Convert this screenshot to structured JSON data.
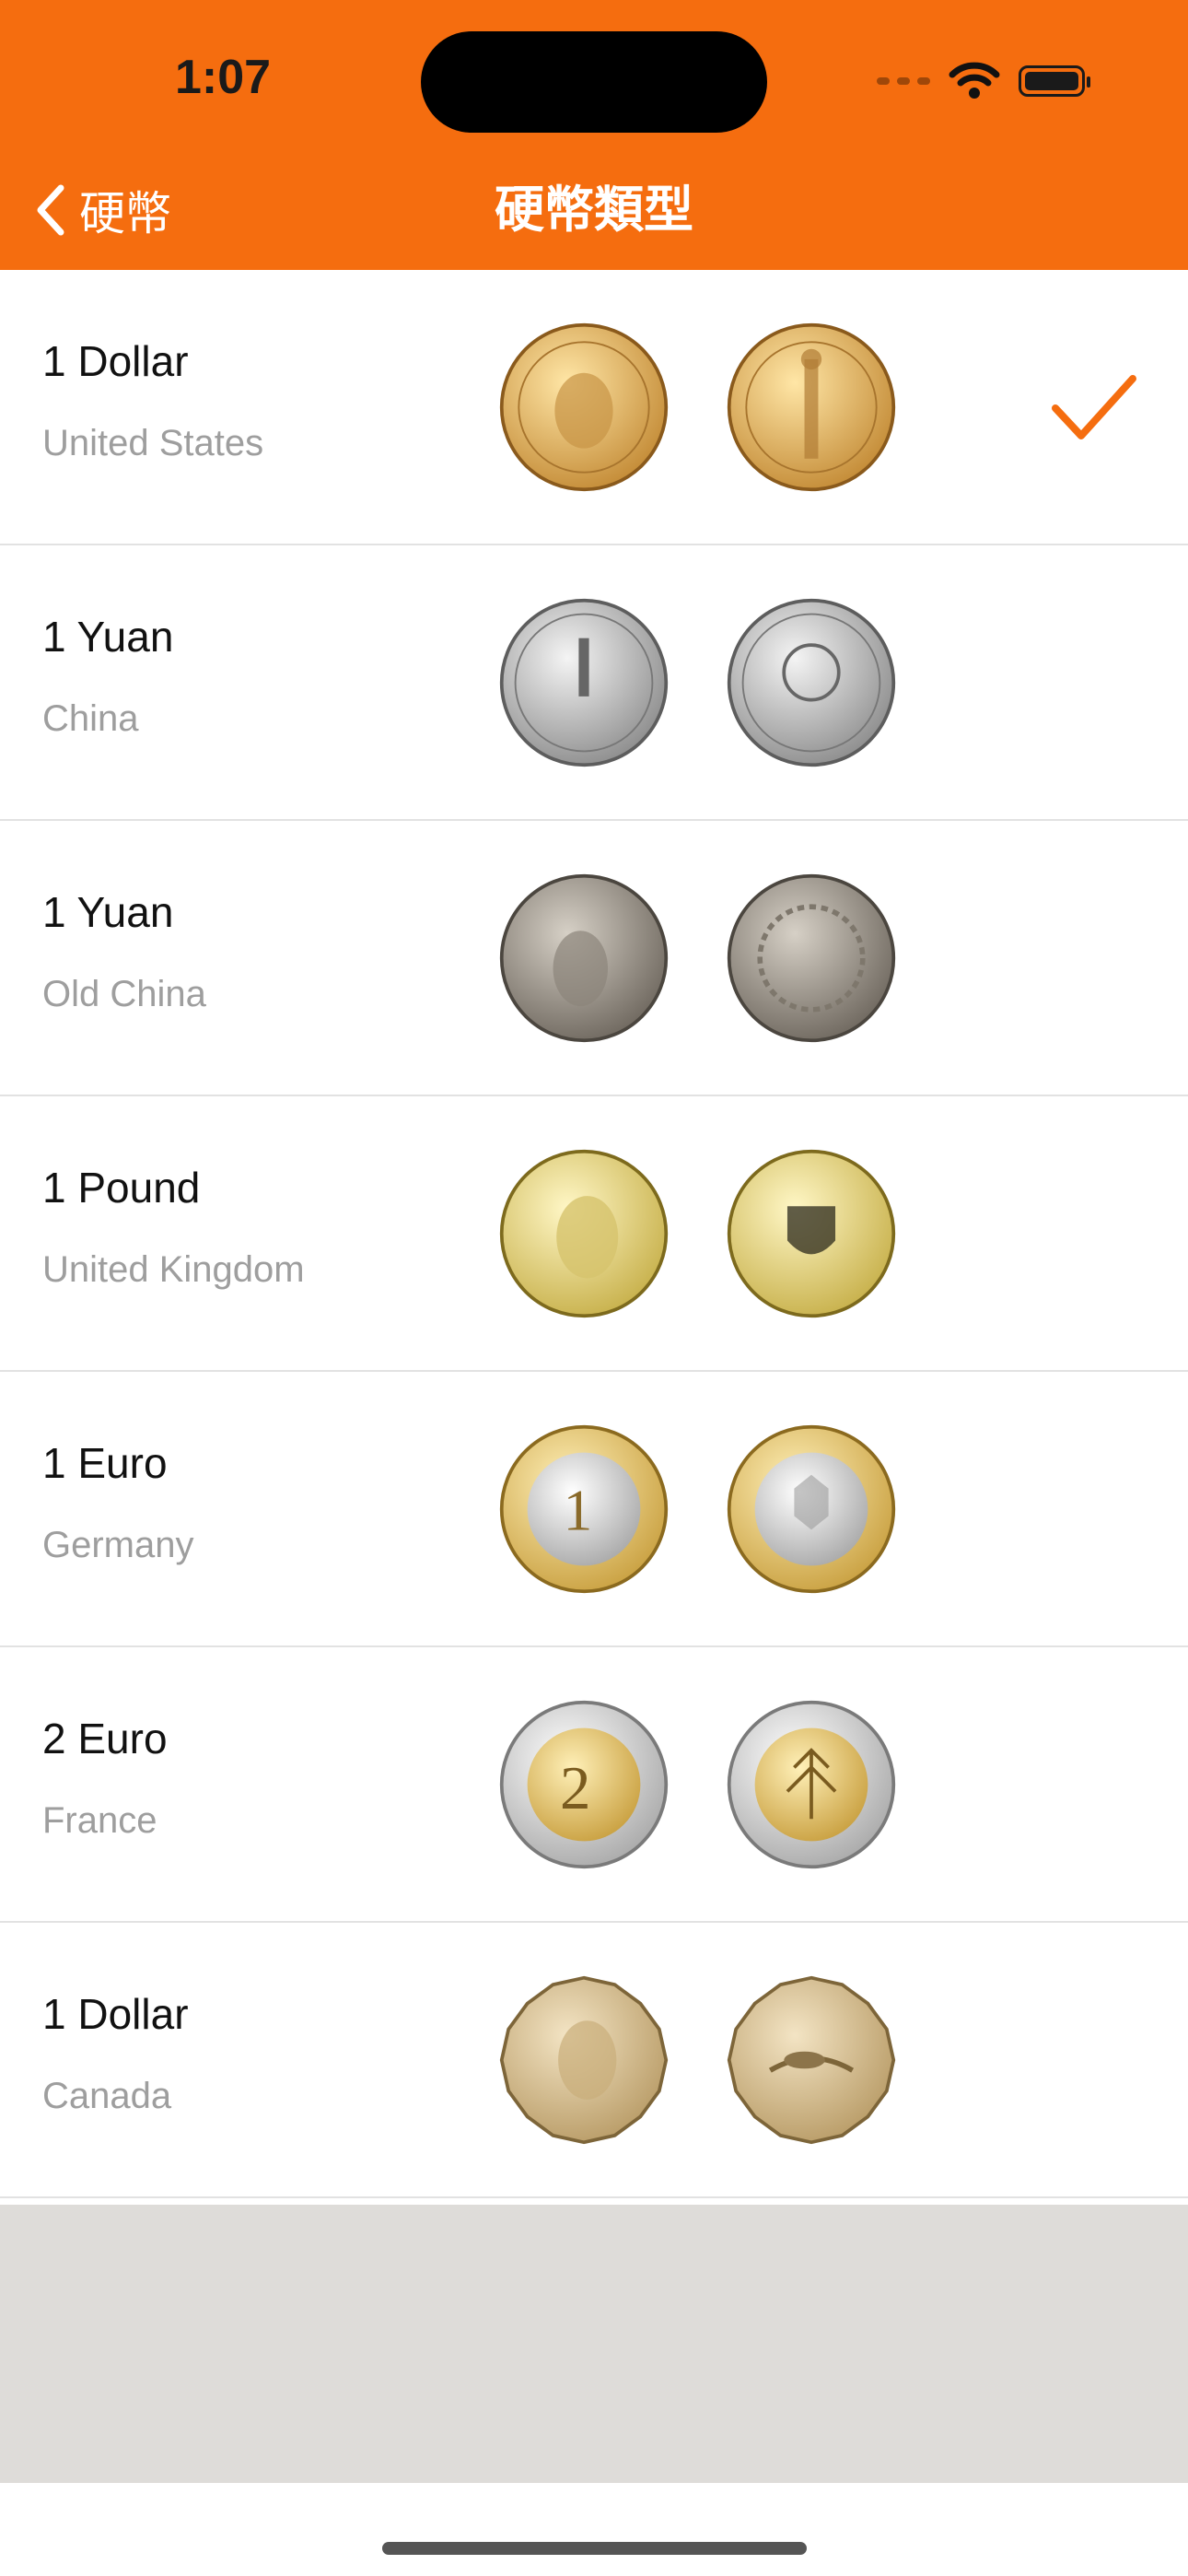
{
  "status_bar": {
    "time": "1:07"
  },
  "nav": {
    "back_label": "硬幣",
    "title": "硬幣類型"
  },
  "colors": {
    "accent": "#f56d0f",
    "footer": "#dedcd9"
  },
  "coins": [
    {
      "name": "1 Dollar",
      "country": "United States",
      "selected": true
    },
    {
      "name": "1 Yuan",
      "country": "China",
      "selected": false
    },
    {
      "name": "1 Yuan",
      "country": "Old China",
      "selected": false
    },
    {
      "name": "1 Pound",
      "country": "United Kingdom",
      "selected": false
    },
    {
      "name": "1 Euro",
      "country": "Germany",
      "selected": false
    },
    {
      "name": "2 Euro",
      "country": "France",
      "selected": false
    },
    {
      "name": "1 Dollar",
      "country": "Canada",
      "selected": false
    }
  ],
  "icons": {
    "back": "chevron-left-icon",
    "check": "checkmark-icon",
    "wifi": "wifi-icon",
    "battery": "battery-icon"
  }
}
